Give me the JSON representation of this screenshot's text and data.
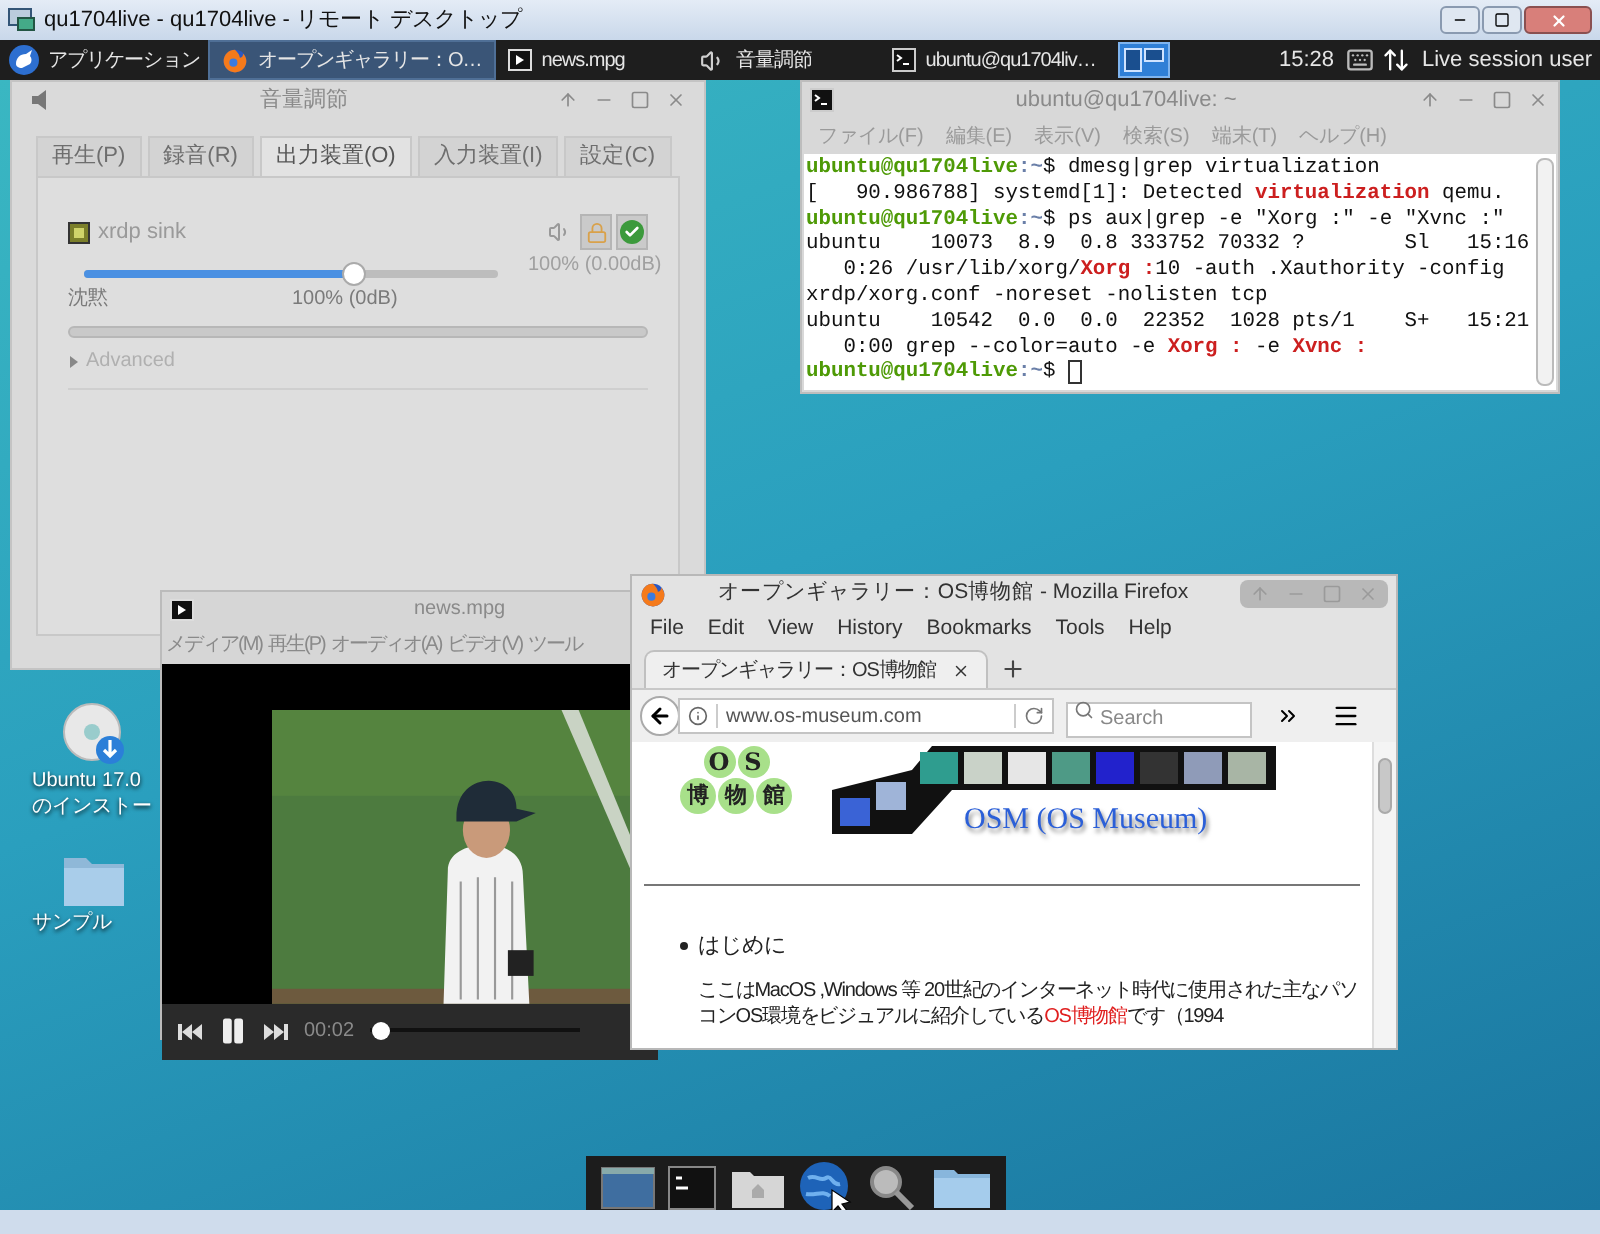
{
  "rdp_window": {
    "title": "qu1704live - qu1704live - リモート デスクトップ"
  },
  "panel": {
    "app_menu": "アプリケーション",
    "tasks": [
      {
        "kind": "firefox",
        "label": "オープンギャラリー：O…",
        "selected": true
      },
      {
        "kind": "video",
        "label": "news.mpg",
        "selected": false
      },
      {
        "kind": "volume",
        "label": "音量調節",
        "selected": false
      },
      {
        "kind": "terminal",
        "label": "ubuntu@qu1704liv…",
        "selected": false
      }
    ],
    "clock": "15:28",
    "user": "Live session user"
  },
  "desktop_icons": [
    {
      "kind": "disc",
      "label_lines": [
        "Ubuntu 17.0",
        "のインストー"
      ]
    },
    {
      "kind": "folder",
      "label_lines": [
        "サンプル"
      ]
    }
  ],
  "volume_window": {
    "title": "音量調節",
    "tabs": [
      {
        "label": "再生(P)",
        "selected": false
      },
      {
        "label": "録音(R)",
        "selected": false
      },
      {
        "label": "出力装置(O)",
        "selected": true
      },
      {
        "label": "入力装置(I)",
        "selected": false
      },
      {
        "label": "設定(C)",
        "selected": false
      }
    ],
    "device": {
      "name": "xrdp sink",
      "level": 0.65,
      "reading": "100% (0.00dB)",
      "min_label": "沈黙",
      "mid_label": "100% (0dB)"
    },
    "advanced": {
      "label": "Advanced",
      "expanded": false
    }
  },
  "terminal": {
    "title": "ubuntu@qu1704live: ~",
    "menu": [
      "ファイル(F)",
      "編集(E)",
      "表示(V)",
      "検索(S)",
      "端末(T)",
      "ヘルプ(H)"
    ],
    "cursor": true,
    "lines": [
      [
        {
          "kind": "prompt",
          "text": "ubuntu@qu1704live"
        },
        {
          "kind": "path",
          "text": ":~"
        },
        {
          "kind": "text",
          "text": "$ dmesg|grep virtualization"
        }
      ],
      [
        {
          "kind": "text",
          "text": "[   90.986788] systemd[1]: Detected "
        },
        {
          "kind": "match",
          "text": "virtualization"
        },
        {
          "kind": "text",
          "text": " qemu."
        }
      ],
      [
        {
          "kind": "prompt",
          "text": "ubuntu@qu1704live"
        },
        {
          "kind": "path",
          "text": ":~"
        },
        {
          "kind": "text",
          "text": "$ ps aux|grep -e \"Xorg :\" -e \"Xvnc :\""
        }
      ],
      [
        {
          "kind": "text",
          "text": "ubuntu    10073  8.9  0.8 333752 70332 ?        Sl   15:16"
        }
      ],
      [
        {
          "kind": "text",
          "text": "   0:26 /usr/lib/xorg/"
        },
        {
          "kind": "match",
          "text": "Xorg :"
        },
        {
          "kind": "text",
          "text": "10 -auth .Xauthority -config"
        }
      ],
      [
        {
          "kind": "text",
          "text": "xrdp/xorg.conf -noreset -nolisten tcp"
        }
      ],
      [
        {
          "kind": "text",
          "text": "ubuntu    10542  0.0  0.0  22352  1028 pts/1    S+   15:21"
        }
      ],
      [
        {
          "kind": "text",
          "text": "   0:00 grep --color=auto -e "
        },
        {
          "kind": "match",
          "text": "Xorg :"
        },
        {
          "kind": "text",
          "text": " -e "
        },
        {
          "kind": "match",
          "text": "Xvnc :"
        }
      ],
      [
        {
          "kind": "prompt",
          "text": "ubuntu@qu1704live"
        },
        {
          "kind": "path",
          "text": ":~"
        },
        {
          "kind": "text",
          "text": "$ "
        }
      ]
    ]
  },
  "video_window": {
    "title": "news.mpg",
    "menu": [
      "メディア(M)",
      "再生(P)",
      "オーディオ(A)",
      "ビデオ(V)",
      "ツール"
    ],
    "time": "00:02",
    "level": 0.01,
    "playing": true
  },
  "firefox": {
    "title": "オープンギャラリー：OS博物館 - Mozilla Firefox",
    "menu": [
      "File",
      "Edit",
      "View",
      "History",
      "Bookmarks",
      "Tools",
      "Help"
    ],
    "tab": "オープンギャラリー：OS博物館",
    "url": "www.os-museum.com",
    "search_placeholder": "Search",
    "logo": {
      "row_1": [
        "O",
        "S"
      ],
      "row_2": [
        "博",
        "物",
        "館"
      ]
    },
    "banner_title": "OSM (OS Museum)",
    "bullet": "はじめに",
    "paragraph": {
      "before": "ここはMacOS ,Windows 等 20世紀のインターネット時代に使用された主なパソコンOS環境をビジュアルに紹介している",
      "link": "OS博物館",
      "after": "です（1994"
    }
  }
}
